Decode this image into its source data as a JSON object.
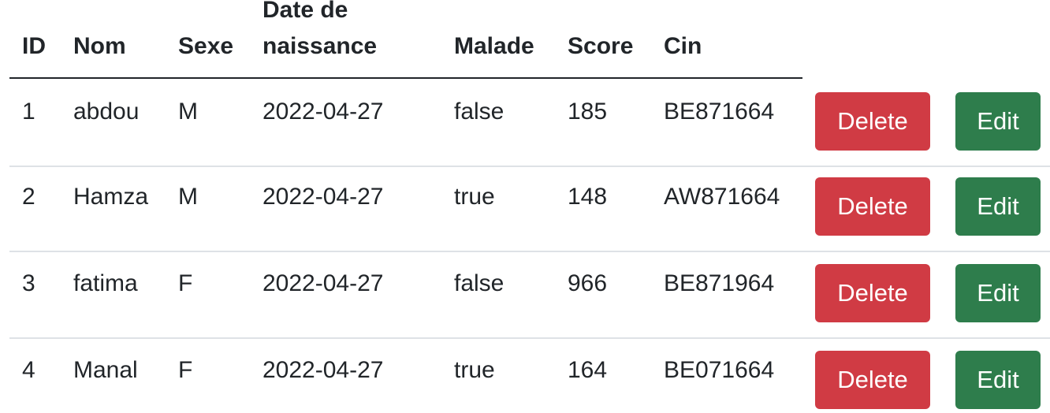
{
  "table": {
    "headers": {
      "id": "ID",
      "nom": "Nom",
      "sexe": "Sexe",
      "date_line1": "Date de",
      "date_line2": "naissance",
      "malade": "Malade",
      "score": "Score",
      "cin": "Cin"
    },
    "rows": [
      {
        "id": "1",
        "nom": "abdou",
        "sexe": "M",
        "date": "2022-04-27",
        "malade": "false",
        "score": "185",
        "cin": "BE871664",
        "delete_label": "Delete",
        "edit_label": "Edit"
      },
      {
        "id": "2",
        "nom": "Hamza",
        "sexe": "M",
        "date": "2022-04-27",
        "malade": "true",
        "score": "148",
        "cin": "AW871664",
        "delete_label": "Delete",
        "edit_label": "Edit"
      },
      {
        "id": "3",
        "nom": "fatima",
        "sexe": "F",
        "date": "2022-04-27",
        "malade": "false",
        "score": "966",
        "cin": "BE871964",
        "delete_label": "Delete",
        "edit_label": "Edit"
      },
      {
        "id": "4",
        "nom": "Manal",
        "sexe": "F",
        "date": "2022-04-27",
        "malade": "true",
        "score": "164",
        "cin": "BE071664",
        "delete_label": "Delete",
        "edit_label": "Edit"
      }
    ]
  },
  "colors": {
    "delete_button": "#d03b44",
    "edit_button": "#2e7d4c",
    "text": "#212529",
    "row_separator": "#dee2e6"
  }
}
